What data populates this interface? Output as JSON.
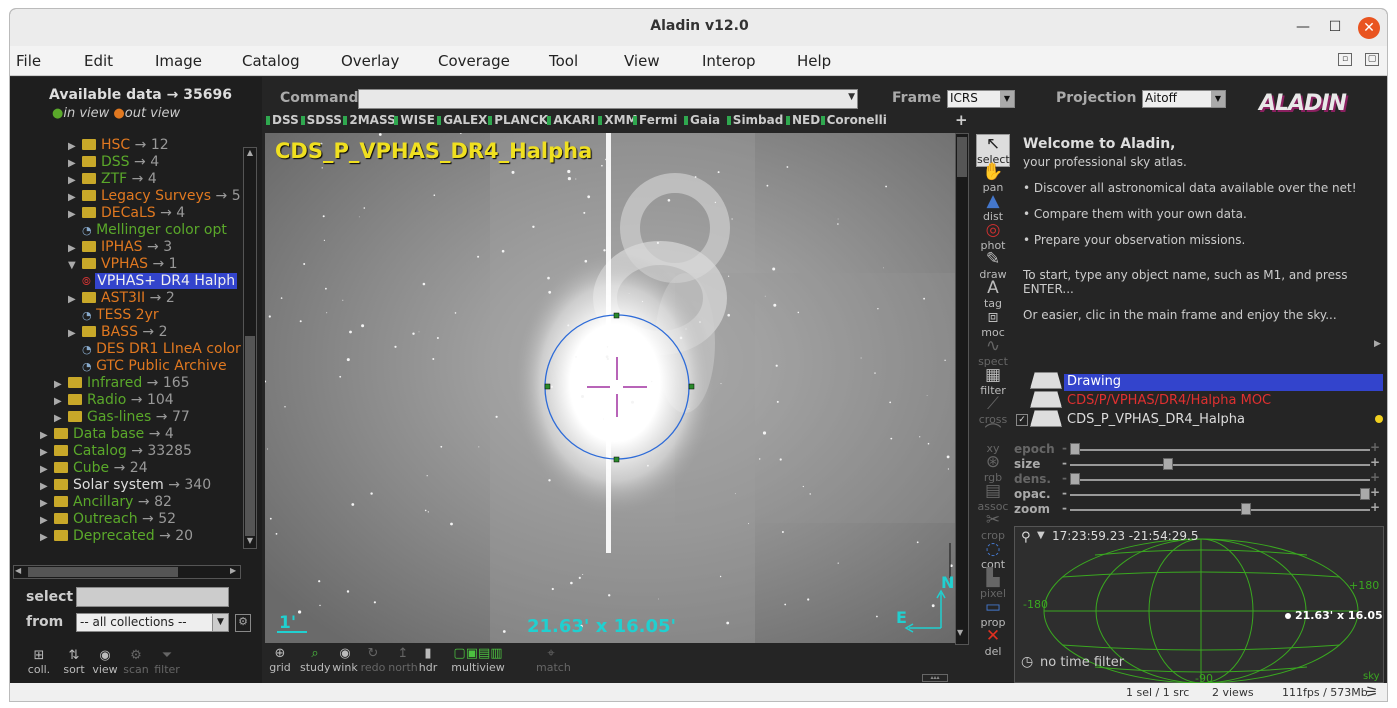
{
  "window": {
    "title": "Aladin v12.0"
  },
  "menu": [
    "File",
    "Edit",
    "Image",
    "Catalog",
    "Overlay",
    "Coverage",
    "Tool",
    "View",
    "Interop",
    "Help"
  ],
  "left": {
    "available": "Available data → 35696",
    "in_view": "in view",
    "out_view": "out view",
    "tree": [
      {
        "label": "HSC",
        "count": "→ 12",
        "color": "orange",
        "indent": 1,
        "type": "folder"
      },
      {
        "label": "DSS",
        "count": "→ 4",
        "color": "green",
        "indent": 1,
        "type": "folder"
      },
      {
        "label": "ZTF",
        "count": "→ 4",
        "color": "green",
        "indent": 1,
        "type": "folder"
      },
      {
        "label": "Legacy Surveys",
        "count": "→ 5",
        "color": "orange",
        "indent": 1,
        "type": "folder"
      },
      {
        "label": "DECaLS",
        "count": "→ 4",
        "color": "orange",
        "indent": 1,
        "type": "folder"
      },
      {
        "label": "Mellinger color opt",
        "count": "",
        "color": "green",
        "indent": 2,
        "type": "item"
      },
      {
        "label": "IPHAS",
        "count": "→ 3",
        "color": "orange",
        "indent": 1,
        "type": "folder"
      },
      {
        "label": "VPHAS",
        "count": "→ 1",
        "color": "orange",
        "indent": 1,
        "type": "folder-open"
      },
      {
        "label": "VPHAS+ DR4 Halph",
        "count": "",
        "color": "white",
        "indent": 2,
        "type": "selected"
      },
      {
        "label": "AST3II",
        "count": "→ 2",
        "color": "orange",
        "indent": 1,
        "type": "folder"
      },
      {
        "label": "TESS 2yr",
        "count": "",
        "color": "orange",
        "indent": 2,
        "type": "item"
      },
      {
        "label": "BASS",
        "count": "→ 2",
        "color": "orange",
        "indent": 1,
        "type": "folder"
      },
      {
        "label": "DES DR1 LIneA color",
        "count": "",
        "color": "orange",
        "indent": 2,
        "type": "item"
      },
      {
        "label": "GTC Public Archive",
        "count": "",
        "color": "orange",
        "indent": 2,
        "type": "item"
      },
      {
        "label": "Infrared",
        "count": "→ 165",
        "color": "green",
        "indent": 0,
        "type": "folder"
      },
      {
        "label": "Radio",
        "count": "→ 104",
        "color": "green",
        "indent": 0,
        "type": "folder"
      },
      {
        "label": "Gas-lines",
        "count": "→ 77",
        "color": "green",
        "indent": 0,
        "type": "folder"
      },
      {
        "label": "Data base",
        "count": "→ 4",
        "color": "green",
        "indent": -1,
        "type": "folder"
      },
      {
        "label": "Catalog",
        "count": "→ 33285",
        "color": "green",
        "indent": -1,
        "type": "folder"
      },
      {
        "label": "Cube",
        "count": "→ 24",
        "color": "green",
        "indent": -1,
        "type": "folder"
      },
      {
        "label": "Solar system",
        "count": "→ 340",
        "color": "white",
        "indent": -1,
        "type": "folder"
      },
      {
        "label": "Ancillary",
        "count": "→ 82",
        "color": "green",
        "indent": -1,
        "type": "folder"
      },
      {
        "label": "Outreach",
        "count": "→ 52",
        "color": "green",
        "indent": -1,
        "type": "folder"
      },
      {
        "label": "Deprecated",
        "count": "→ 20",
        "color": "green",
        "indent": -1,
        "type": "folder"
      }
    ],
    "select_label": "select",
    "from_label": "from",
    "from_value": "-- all collections --",
    "bottom_buttons": [
      {
        "label": "coll.",
        "icon": "⊞",
        "dim": false
      },
      {
        "label": "sort",
        "icon": "⇅",
        "dim": false
      },
      {
        "label": "view",
        "icon": "◉",
        "dim": false
      },
      {
        "label": "scan",
        "icon": "⚙",
        "dim": true
      },
      {
        "label": "filter",
        "icon": "⏷",
        "dim": true
      }
    ]
  },
  "command": {
    "label": "Command",
    "value": ""
  },
  "frame": {
    "label": "Frame",
    "value": "ICRS"
  },
  "projection": {
    "label": "Projection",
    "value": "Aitoff"
  },
  "surveys": [
    "DSS",
    "SDSS",
    "2MASS",
    "WISE",
    "GALEX",
    "PLANCK",
    "AKARI",
    "XMM",
    "Fermi",
    "Gaia",
    "Simbad",
    "NED",
    "Coronelli"
  ],
  "view": {
    "label": "CDS_P_VPHAS_DR4_Halpha",
    "scale": "1'",
    "fov": "21.63' x 16.05'",
    "north": "N",
    "east": "E"
  },
  "view_tools": [
    {
      "label": "grid",
      "icon": "⊕",
      "dim": false
    },
    {
      "label": "study",
      "icon": "⌕",
      "dim": false
    },
    {
      "label": "wink",
      "icon": "◉",
      "dim": false
    },
    {
      "label": "redo",
      "icon": "↻",
      "dim": true
    },
    {
      "label": "north",
      "icon": "↥",
      "dim": true
    },
    {
      "label": "hdr",
      "icon": "▮",
      "dim": false
    },
    {
      "label": "multiview",
      "icon": "▢▣▤▥",
      "dim": false
    },
    {
      "label": "match",
      "icon": "⌖",
      "dim": true
    }
  ],
  "tools": [
    {
      "label": "select",
      "icon": "↖",
      "dim": false
    },
    {
      "label": "pan",
      "icon": "✋",
      "dim": false
    },
    {
      "label": "dist",
      "icon": "▲",
      "dim": false
    },
    {
      "label": "phot",
      "icon": "◎",
      "dim": false
    },
    {
      "label": "draw",
      "icon": "✎",
      "dim": false
    },
    {
      "label": "tag",
      "icon": "A",
      "dim": false
    },
    {
      "label": "moc",
      "icon": "⧈",
      "dim": false
    },
    {
      "label": "spect",
      "icon": "∿",
      "dim": true
    },
    {
      "label": "filter",
      "icon": "▦",
      "dim": false
    },
    {
      "label": "cross",
      "icon": "⟋",
      "dim": true
    },
    {
      "label": "xy",
      "icon": "⌒",
      "dim": true
    },
    {
      "label": "rgb",
      "icon": "⊛",
      "dim": true
    },
    {
      "label": "assoc",
      "icon": "▤",
      "dim": true
    },
    {
      "label": "crop",
      "icon": "✂",
      "dim": true
    },
    {
      "label": "cont",
      "icon": "◌",
      "dim": false
    },
    {
      "label": "pixel",
      "icon": "▙",
      "dim": true
    },
    {
      "label": "prop",
      "icon": "▭",
      "dim": false
    },
    {
      "label": "del",
      "icon": "✕",
      "dim": false
    }
  ],
  "welcome": {
    "title": "Welcome to Aladin,",
    "subtitle": "your professional sky atlas.",
    "bullets": [
      "Discover all astronomical data available over the net!",
      "Compare them with your own data.",
      "Prepare your observation missions."
    ],
    "p1": "To start, type any object name, such as M1, and press ENTER...",
    "p2": "Or easier, clic in the main frame and enjoy the sky..."
  },
  "logo": "ALADIN",
  "planes": [
    {
      "label": "Drawing",
      "color": "#ffffff",
      "selected": true
    },
    {
      "label": "CDS/P/VPHAS/DR4/Halpha MOC",
      "color": "#e03030",
      "selected": false
    },
    {
      "label": "CDS_P_VPHAS_DR4_Halpha",
      "color": "#dddddd",
      "selected": false
    }
  ],
  "sliders": [
    {
      "label": "epoch",
      "value": 0.0,
      "dim": true
    },
    {
      "label": "size",
      "value": 0.32,
      "dim": false
    },
    {
      "label": "dens.",
      "value": 0.0,
      "dim": true
    },
    {
      "label": "opac.",
      "value": 1.0,
      "dim": false
    },
    {
      "label": "zoom",
      "value": 0.59,
      "dim": false
    }
  ],
  "mini": {
    "coords": "17:23:59.23 -21:54:29.5",
    "lon_left": "-180",
    "lon_right": "+180",
    "lat_bottom": "-90",
    "fov": "21.63' x 16.05",
    "time": "no time filter",
    "sky": "sky"
  },
  "status": {
    "sel": "1 sel / 1 src",
    "views": "2 views",
    "fps": "111fps / 573Mb"
  },
  "colors": {
    "accent": "#3344cc",
    "view_label": "#f0e020",
    "cyan": "#20d0d0"
  }
}
